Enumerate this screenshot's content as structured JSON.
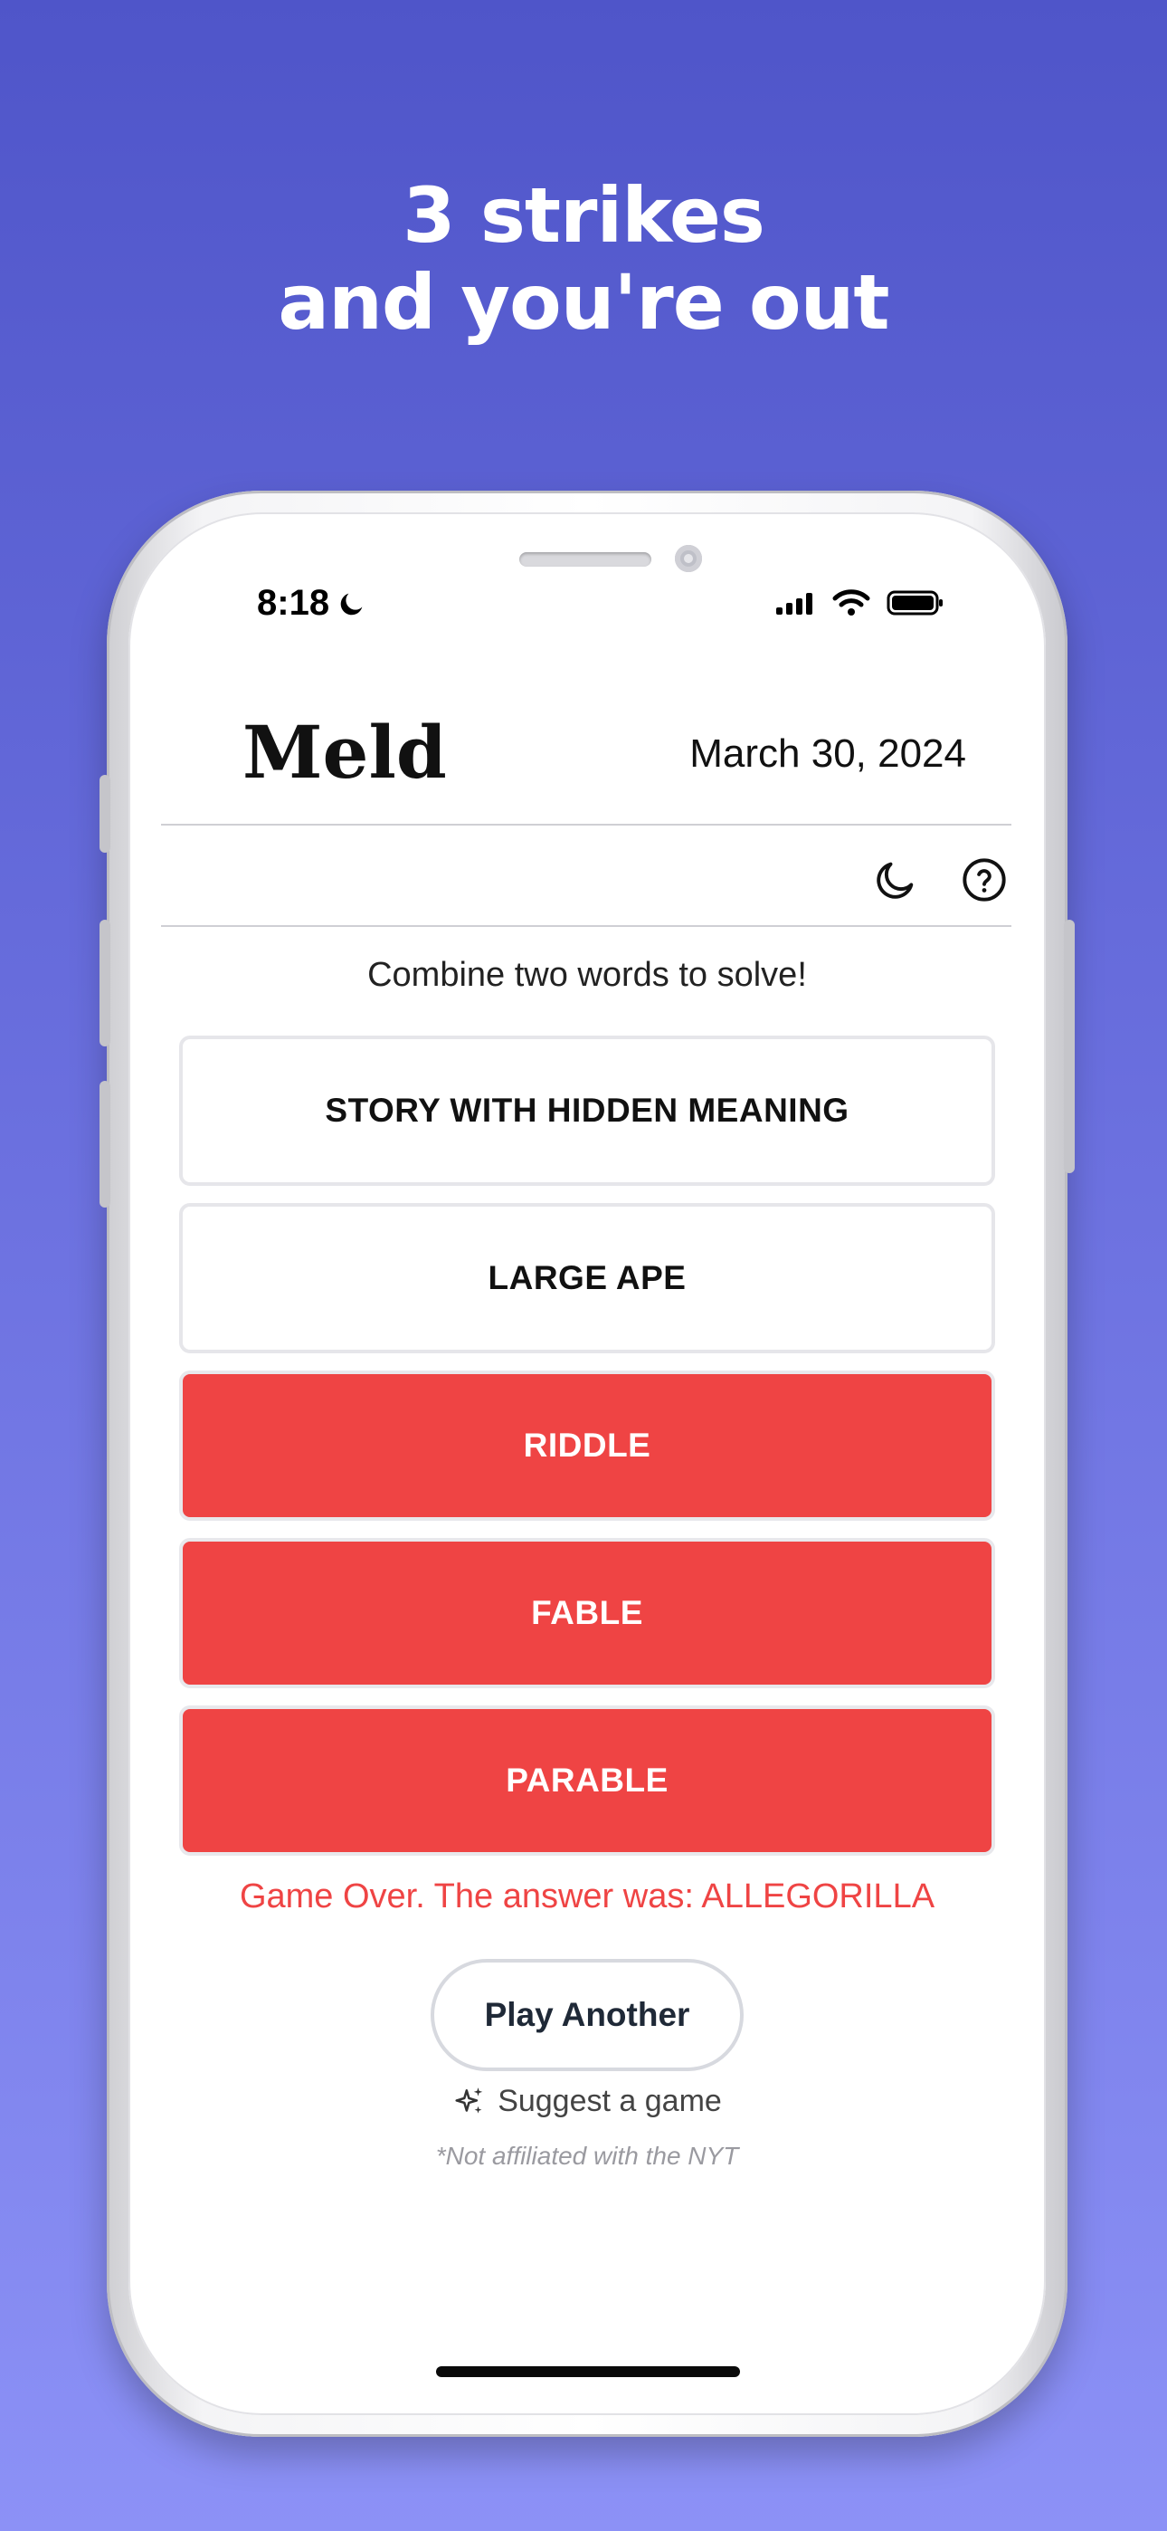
{
  "headline": {
    "line1": "3 strikes",
    "line2": "and you're out"
  },
  "status_bar": {
    "time": "8:18",
    "focus_icon": "moon-icon",
    "icons": [
      "cellular-signal-icon",
      "wifi-icon",
      "battery-icon"
    ]
  },
  "app": {
    "logo": "Meld",
    "date": "March 30, 2024",
    "toolbar": {
      "dark_mode_icon": "moon-icon",
      "help_icon": "question-circle-icon"
    },
    "instructions": "Combine two words to solve!",
    "clues": [
      {
        "label": "STORY WITH HIDDEN MEANING",
        "state": "clue"
      },
      {
        "label": "LARGE APE",
        "state": "clue"
      }
    ],
    "guesses": [
      {
        "label": "RIDDLE",
        "state": "wrong"
      },
      {
        "label": "FABLE",
        "state": "wrong"
      },
      {
        "label": "PARABLE",
        "state": "wrong"
      }
    ],
    "result": "Game Over. The answer was: ALLEGORILLA",
    "play_another": "Play Another",
    "suggest": "Suggest a game",
    "disclaimer": "*Not affiliated with the NYT"
  },
  "colors": {
    "wrong": "#ef4444",
    "background_top": "#4f55c9",
    "background_bottom": "#8c91f6"
  }
}
